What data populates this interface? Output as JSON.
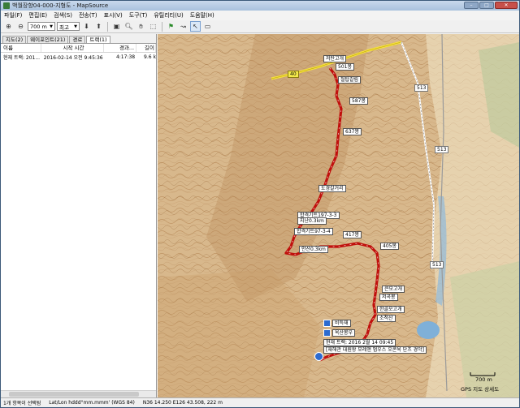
{
  "window": {
    "title": "백월장항04-000-지형도 - MapSource"
  },
  "menu": [
    "파일(F)",
    "편집(E)",
    "검색(S)",
    "전송(T)",
    "표시(V)",
    "도구(T)",
    "유틸리티(U)",
    "도움말(H)"
  ],
  "toolbar": {
    "zoom_value": "700 m",
    "detail_value": "최고"
  },
  "tabs": [
    "지도(2)",
    "웨이포인트(21)",
    "경로",
    "트랙(1)"
  ],
  "table": {
    "headers": [
      "이름",
      "시작 시간",
      "경과...",
      "길이"
    ],
    "rows": [
      [
        "현재 트랙: 201...",
        "2016-02-14 오전 9:45:36",
        "4:17:38",
        "9.6 k"
      ]
    ]
  },
  "map": {
    "labels": [
      "저탄고개",
      "501봉",
      "철탑갈림",
      "587봉",
      "637봉",
      "도경갈거리",
      "합격기트197-3-3",
      "지난0.3km",
      "합격기트97-3-4",
      "417봉",
      "405봉",
      "안산0.3km",
      "큰모고개",
      "저곡봉",
      "한골모고개",
      "소적산",
      "비득재",
      "옥산봉우",
      "현재 트랙: 2016 2월 14 09:45",
      "[재해관 대원왕 모레앤 멈우스 오콘옥 단츠 경악]"
    ],
    "road_numbers": [
      "40",
      "513",
      "513",
      "513"
    ],
    "scale": "700 m",
    "credit": "GPS 지도 상세도"
  },
  "status": {
    "selection": "1개 항목이 선택됨",
    "format": "Lat/Lon hddd°mm.mmm' (WGS 84)",
    "coords": "N36 14.250 E126 43.508, 222 m"
  }
}
